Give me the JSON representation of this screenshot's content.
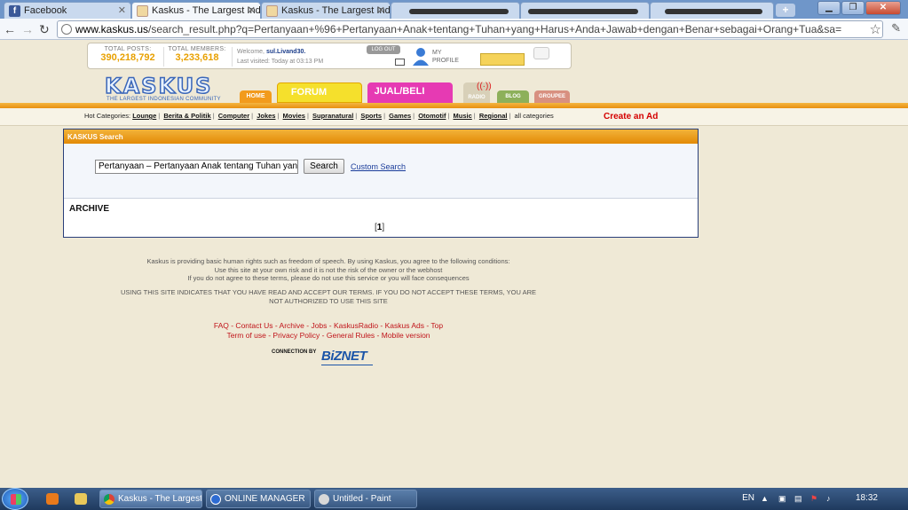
{
  "browser": {
    "tabs": [
      {
        "title": "Facebook",
        "icon": "facebook-icon"
      },
      {
        "title": "Kaskus - The Largest Indon",
        "icon": "kaskus-icon"
      },
      {
        "title": "Kaskus - The Largest Indon",
        "icon": "kaskus-icon"
      }
    ],
    "new_tab": "+",
    "url_domain": "www.kaskus.us",
    "url_path": "/search_result.php?q=Pertanyaan+%96+Pertanyaan+Anak+tentang+Tuhan+yang+Harus+Anda+Jawab+dengan+Benar+sebagai+Orang+Tua&sa="
  },
  "header": {
    "total_posts_label": "TOTAL POSTS:",
    "total_posts": "390,218,792",
    "total_members_label": "TOTAL MEMBERS:",
    "total_members": "3,233,618",
    "welcome_prefix": "Welcome,",
    "username": "sul.Livand30.",
    "last_visited": "Last visited: Today at 03:13 PM",
    "logout": "LOG OUT",
    "my": "MY",
    "profile": "PROFILE"
  },
  "logo": {
    "name": "KASKUS",
    "tagline": "THE LARGEST INDONESIAN COMMUNITY"
  },
  "nav": {
    "home": "HOME",
    "forum": "FORUM",
    "jual_beli": "JUAL/BELI",
    "radio": "RADIO",
    "blog": "BLOG",
    "groupee": "GROUPEE"
  },
  "categories": {
    "label": "Hot Categories:",
    "items": [
      "Lounge",
      "Berita & Politik",
      "Computer",
      "Jokes",
      "Movies",
      "Supranatural",
      "Sports",
      "Games",
      "Otomotif",
      "Music",
      "Regional"
    ],
    "all": "all categories",
    "create_ad": "Create an Ad"
  },
  "search": {
    "panel_title": "KASKUS Search",
    "query": "Pertanyaan – Pertanyaan Anak tentang Tuhan yang",
    "button": "Search",
    "custom_link": "Custom Search",
    "archive_label": "ARCHIVE",
    "page_open": "[",
    "page_current": "1",
    "page_close": "]"
  },
  "footer": {
    "disclaimer_1": "Kaskus is providing basic human rights such as freedom of speech. By using Kaskus, you agree to the following conditions:",
    "disclaimer_2": "Use this site at your own risk and it is not the risk of the owner or the webhost",
    "disclaimer_3": "If you do not agree to these terms, please do not use this service or you will face consequences",
    "terms_1": "USING THIS SITE INDICATES THAT YOU HAVE READ AND ACCEPT OUR TERMS. IF YOU DO NOT ACCEPT THESE TERMS, YOU ARE",
    "terms_2": "NOT AUTHORIZED TO USE THIS SITE",
    "links_1": "FAQ - Contact Us - Archive - Jobs - KaskusRadio - Kaskus Ads - Top",
    "links_2": "Term of use - Privacy Policy - General Rules - Mobile version",
    "connection_by": "CONNECTION BY",
    "biznet": "BiZNET"
  },
  "taskbar": {
    "tasks": [
      {
        "label": "Kaskus - The Largest ...",
        "icon": "chrome-icon"
      },
      {
        "label": "ONLINE MANAGER",
        "icon": "online-manager-icon"
      },
      {
        "label": "Untitled - Paint",
        "icon": "paint-icon"
      }
    ],
    "lang": "EN",
    "clock": "18:32"
  }
}
